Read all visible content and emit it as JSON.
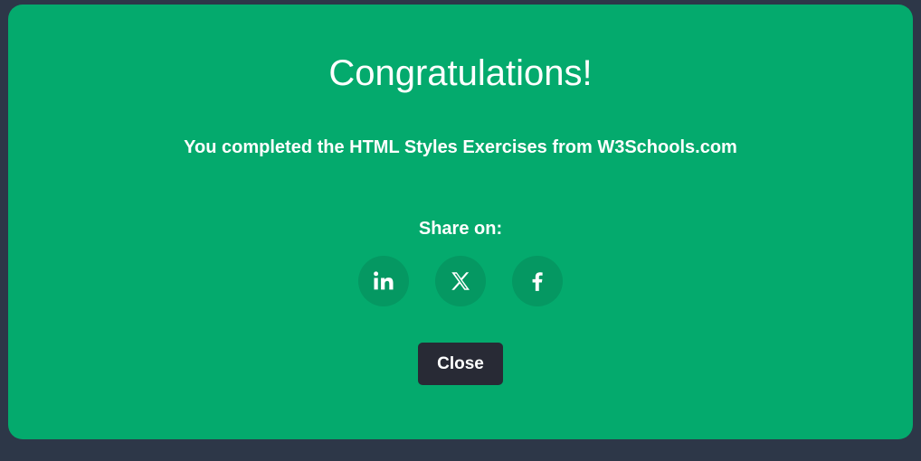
{
  "modal": {
    "title": "Congratulations!",
    "subtitle": "You completed the HTML Styles Exercises from W3Schools.com",
    "share_label": "Share on:",
    "share_buttons": [
      {
        "icon": "linkedin-icon"
      },
      {
        "icon": "x-icon"
      },
      {
        "icon": "facebook-icon"
      }
    ],
    "close_label": "Close"
  },
  "colors": {
    "background": "#2d3748",
    "modal": "#04aa6d",
    "share_button": "#059862",
    "close_button": "#282a35",
    "text": "#ffffff"
  }
}
